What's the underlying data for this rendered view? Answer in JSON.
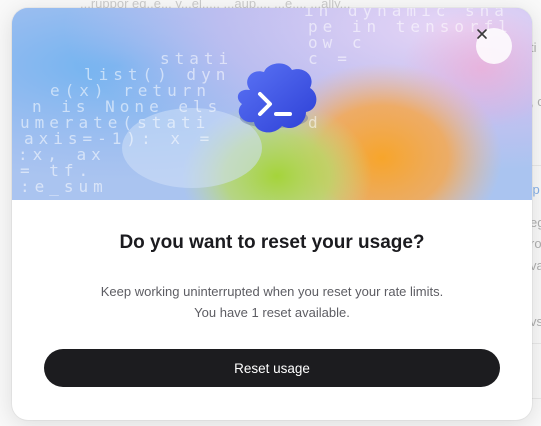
{
  "background": {
    "top_text": "...ruppor eq..e... y...el..... ...aup..., ...e.... ...ally...",
    "right_fragments": [
      "ti",
      ", c",
      "sp",
      "eg",
      "ro",
      "va",
      "vs"
    ]
  },
  "hero": {
    "code_lines": [
      "stati",
      "list() dyn",
      "e(x) return",
      "n is None els",
      "umerate(stati",
      "axis=-1): x =",
      ":x, ax",
      "= tf.",
      ":e_sum",
      "in dynamic sha",
      "pe in tensorfl",
      "ow c",
      "c =",
      "d"
    ],
    "icon": "terminal-cloud-icon"
  },
  "dialog": {
    "close_icon": "close-icon",
    "title": "Do you want to reset your usage?",
    "description_line1": "Keep working uninterrupted when you reset your rate limits.",
    "description_line2": "You have 1 reset available.",
    "reset_label": "Reset usage"
  },
  "colors": {
    "button_bg": "#1c1c1f",
    "icon_blue": "#3d57e6",
    "link_blue": "#4a8be0"
  }
}
